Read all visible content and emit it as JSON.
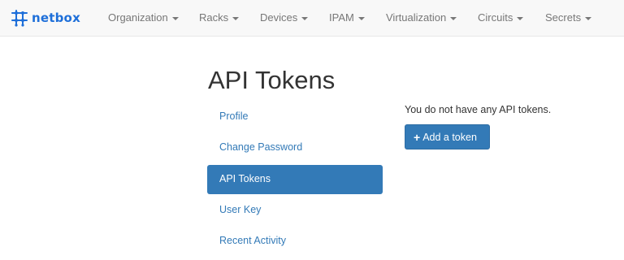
{
  "navbar": {
    "brand": "netbox",
    "brand_icon": "netbox-logo-icon",
    "menus": [
      {
        "label": "Organization",
        "icon": "caret-down-icon"
      },
      {
        "label": "Racks",
        "icon": "caret-down-icon"
      },
      {
        "label": "Devices",
        "icon": "caret-down-icon"
      },
      {
        "label": "IPAM",
        "icon": "caret-down-icon"
      },
      {
        "label": "Virtualization",
        "icon": "caret-down-icon"
      },
      {
        "label": "Circuits",
        "icon": "caret-down-icon"
      },
      {
        "label": "Secrets",
        "icon": "caret-down-icon"
      }
    ]
  },
  "page": {
    "title": "API Tokens"
  },
  "sidebar": {
    "items": [
      {
        "label": "Profile",
        "active": false
      },
      {
        "label": "Change Password",
        "active": false
      },
      {
        "label": "API Tokens",
        "active": true
      },
      {
        "label": "User Key",
        "active": false
      },
      {
        "label": "Recent Activity",
        "active": false
      }
    ]
  },
  "content": {
    "empty_message": "You do not have any API tokens.",
    "add_button": {
      "label": "Add a token",
      "icon": "plus-icon"
    }
  },
  "colors": {
    "brand": "#1e6fd9",
    "primary": "#337ab7",
    "navbar_bg": "#f8f8f8",
    "nav_text": "#777777"
  }
}
